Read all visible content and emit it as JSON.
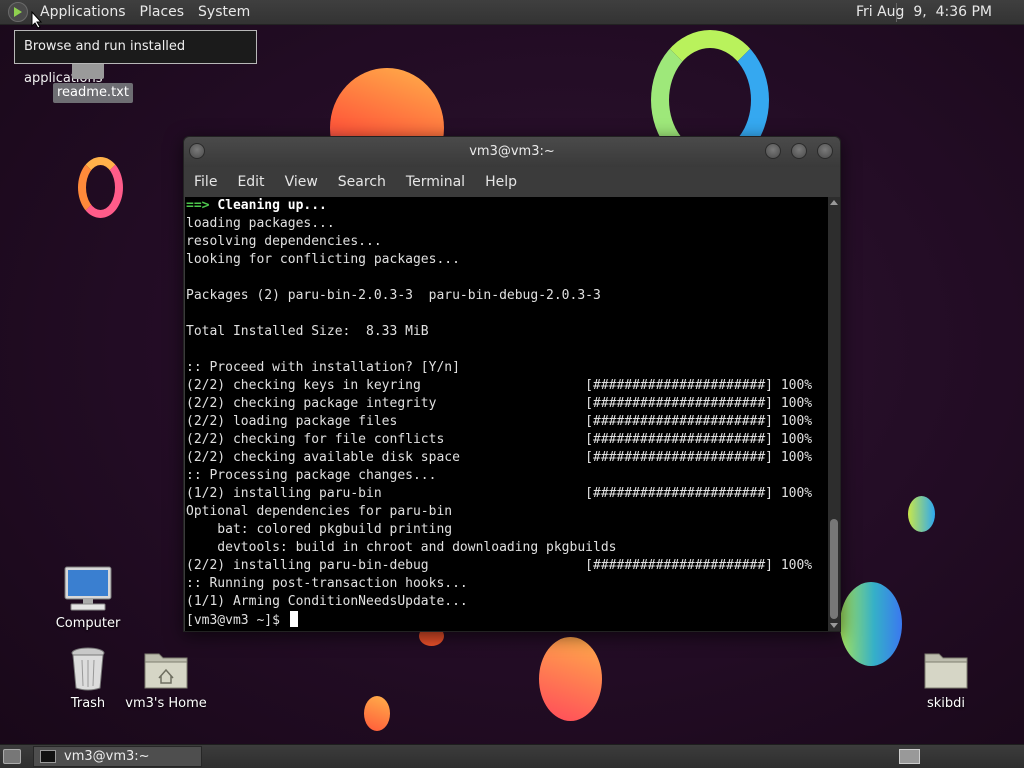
{
  "top_panel": {
    "menus": [
      "Applications",
      "Places",
      "System"
    ],
    "clock": "Fri Aug  9,  4:36 PM"
  },
  "tooltip": "Browse and run installed applications",
  "desktop_icons": {
    "readme": "readme.txt",
    "computer": "Computer",
    "trash": "Trash",
    "home": "vm3's Home",
    "skibdi": "skibdi"
  },
  "terminal": {
    "title": "vm3@vm3:~",
    "menus": [
      "File",
      "Edit",
      "View",
      "Search",
      "Terminal",
      "Help"
    ],
    "arrow": "==>",
    "first_line_text": "Cleaning up...",
    "lines": [
      "loading packages...",
      "resolving dependencies...",
      "looking for conflicting packages...",
      "",
      "Packages (2) paru-bin-2.0.3-3  paru-bin-debug-2.0.3-3",
      "",
      "Total Installed Size:  8.33 MiB",
      "",
      ":: Proceed with installation? [Y/n]",
      "(2/2) checking keys in keyring                     [######################] 100%",
      "(2/2) checking package integrity                   [######################] 100%",
      "(2/2) loading package files                        [######################] 100%",
      "(2/2) checking for file conflicts                  [######################] 100%",
      "(2/2) checking available disk space                [######################] 100%",
      ":: Processing package changes...",
      "(1/2) installing paru-bin                          [######################] 100%",
      "Optional dependencies for paru-bin",
      "    bat: colored pkgbuild printing",
      "    devtools: build in chroot and downloading pkgbuilds",
      "(2/2) installing paru-bin-debug                    [######################] 100%",
      ":: Running post-transaction hooks...",
      "(1/1) Arming ConditionNeedsUpdate..."
    ],
    "prompt": "[vm3@vm3 ~]$ "
  },
  "taskbar": {
    "task_label": "vm3@vm3:~"
  },
  "colors": {
    "terminal_bg": "#000000",
    "arrow_green": "#4ec94e",
    "panel": "#3a3a3a"
  }
}
